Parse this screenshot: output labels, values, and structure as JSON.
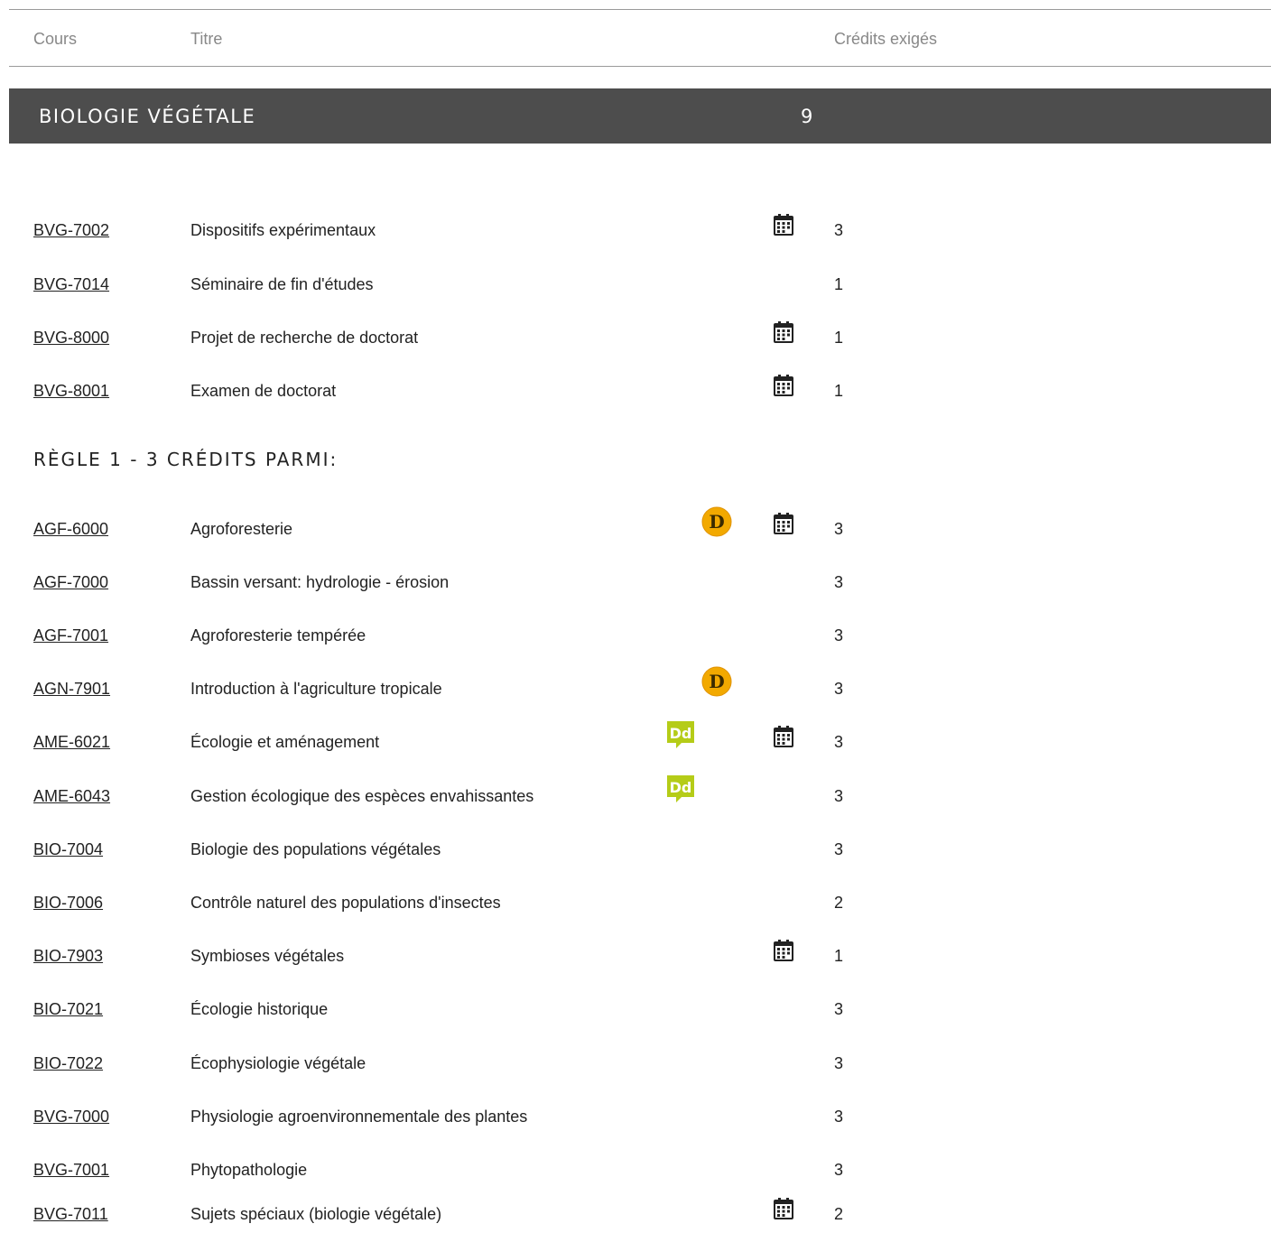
{
  "header": {
    "col_course": "Cours",
    "col_title": "Titre",
    "col_credits": "Crédits exigés"
  },
  "section": {
    "title": "BIOLOGIE VÉGÉTALE",
    "credits": "9"
  },
  "rule_label": "RÈGLE 1 - 3 CRÉDITS PARMI:",
  "required": [
    {
      "code": "BVG-7002",
      "title": "Dispositifs expérimentaux",
      "credits": "3",
      "icons": [
        "calendar-icon"
      ]
    },
    {
      "code": "BVG-7014",
      "title": "Séminaire de fin d'études",
      "credits": "1",
      "icons": []
    },
    {
      "code": "BVG-8000",
      "title": "Projet de recherche de doctorat",
      "credits": "1",
      "icons": [
        "calendar-icon"
      ]
    },
    {
      "code": "BVG-8001",
      "title": "Examen de doctorat",
      "credits": "1",
      "icons": [
        "calendar-icon"
      ]
    }
  ],
  "rule_courses": [
    {
      "code": "AGF-6000",
      "title": "Agroforesterie",
      "credits": "3",
      "icons": [
        "distance-d-icon",
        "calendar-icon"
      ]
    },
    {
      "code": "AGF-7000",
      "title": "Bassin versant: hydrologie - érosion",
      "credits": "3",
      "icons": []
    },
    {
      "code": "AGF-7001",
      "title": "Agroforesterie tempérée",
      "credits": "3",
      "icons": []
    },
    {
      "code": "AGN-7901",
      "title": "Introduction à l'agriculture tropicale",
      "credits": "3",
      "icons": [
        "distance-d-icon"
      ]
    },
    {
      "code": "AME-6021",
      "title": "Écologie et aménagement",
      "credits": "3",
      "icons": [
        "developpement-durable-icon",
        "calendar-icon"
      ]
    },
    {
      "code": "AME-6043",
      "title": "Gestion écologique des espèces envahissantes",
      "credits": "3",
      "icons": [
        "developpement-durable-icon"
      ]
    },
    {
      "code": "BIO-7004",
      "title": "Biologie des populations végétales",
      "credits": "3",
      "icons": []
    },
    {
      "code": "BIO-7006",
      "title": "Contrôle naturel des populations d'insectes",
      "credits": "2",
      "icons": []
    },
    {
      "code": "BIO-7903",
      "title": "Symbioses végétales",
      "credits": "1",
      "icons": [
        "calendar-icon"
      ]
    },
    {
      "code": "BIO-7021",
      "title": "Écologie historique",
      "credits": "3",
      "icons": []
    },
    {
      "code": "BIO-7022",
      "title": "Écophysiologie végétale",
      "credits": "3",
      "icons": []
    },
    {
      "code": "BVG-7000",
      "title": "Physiologie agroenvironnementale des plantes",
      "credits": "3",
      "icons": []
    },
    {
      "code": "BVG-7001",
      "title": "Phytopathologie",
      "credits": "3",
      "icons": []
    },
    {
      "code": "BVG-7011",
      "title": "Sujets spéciaux (biologie végétale)",
      "credits": "2",
      "icons": [
        "calendar-icon"
      ]
    }
  ],
  "badges": {
    "d_letter": "D",
    "dd_letters": "Dd",
    "d_color": "#f2a900",
    "dd_color": "#b5cc18"
  }
}
